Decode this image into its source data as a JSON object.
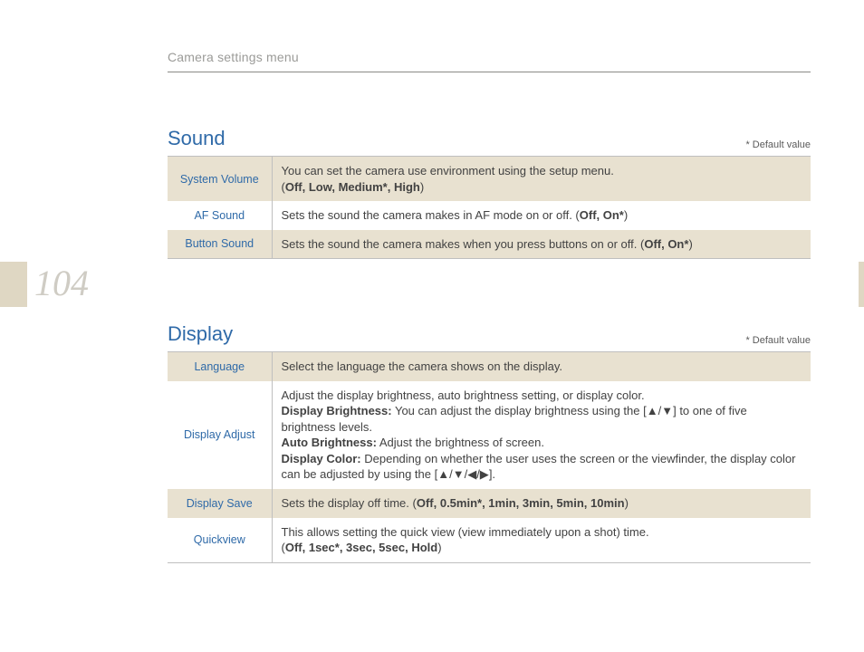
{
  "breadcrumb": "Camera settings menu",
  "page_number": "104",
  "default_note": "* Default value",
  "sections": {
    "sound": {
      "title": "Sound",
      "rows": {
        "system_volume": {
          "label": "System Volume",
          "line1": "You can set the camera use environment using the setup menu.",
          "opts_prefix": "(",
          "opts": "Off, Low, Medium*, High",
          "opts_suffix": ")"
        },
        "af_sound": {
          "label": "AF Sound",
          "line1": "Sets the sound the camera makes in AF mode on or off. (",
          "opts": "Off, On*",
          "suffix": ")"
        },
        "button_sound": {
          "label": "Button Sound",
          "line1": "Sets the sound the camera makes when you press buttons on or off. (",
          "opts": "Off, On*",
          "suffix": ")"
        }
      }
    },
    "display": {
      "title": "Display",
      "rows": {
        "language": {
          "label": "Language",
          "desc": "Select the language the camera shows on the display."
        },
        "display_adjust": {
          "label": "Display Adjust",
          "intro": "Adjust the display brightness, auto brightness setting, or display color.",
          "db_label": "Display Brightness:",
          "db_text_a": " You can adjust the display brightness using the [",
          "db_arrows": "▲/▼",
          "db_text_b": "] to one of five brightness levels.",
          "ab_label": "Auto Brightness:",
          "ab_text": " Adjust the brightness of screen.",
          "dc_label": "Display Color:",
          "dc_text_a": " Depending on whether the user uses the screen or the viewfinder, the display color can be adjusted by using the [",
          "dc_arrows": "▲/▼/◀/▶",
          "dc_text_b": "]."
        },
        "display_save": {
          "label": "Display Save",
          "line1": "Sets the display off time. (",
          "opts": "Off, 0.5min*, 1min, 3min, 5min, 10min",
          "suffix": ")"
        },
        "quickview": {
          "label": "Quickview",
          "line1": "This allows setting the quick view (view immediately upon a shot) time.",
          "opts_prefix": "(",
          "opts": "Off, 1sec*, 3sec, 5sec, Hold",
          "opts_suffix": ")"
        }
      }
    }
  }
}
